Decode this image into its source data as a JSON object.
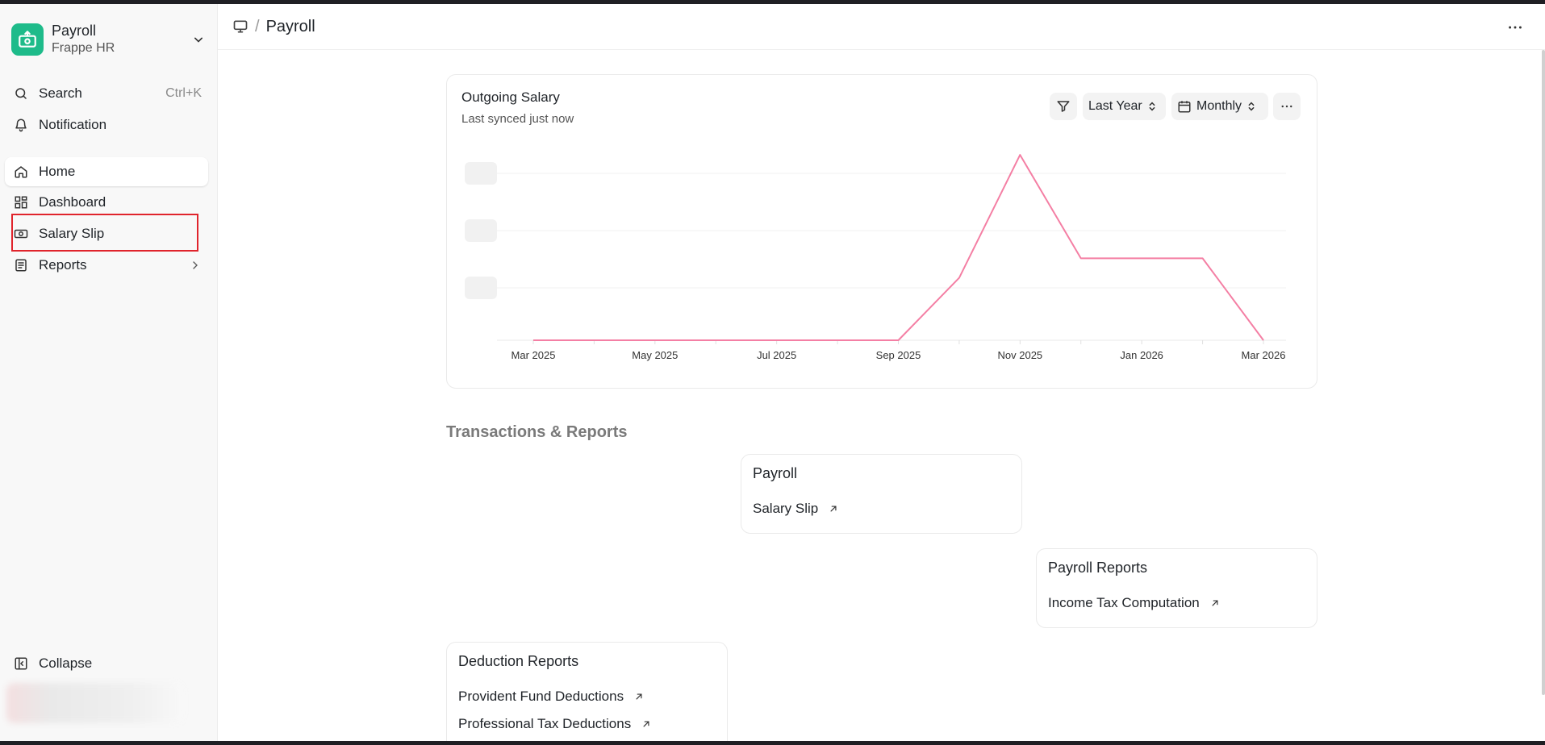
{
  "app": {
    "name": "Payroll",
    "org": "Frappe HR"
  },
  "search": {
    "label": "Search",
    "shortcut": "Ctrl+K"
  },
  "notification": {
    "label": "Notification"
  },
  "sidebar": {
    "items": [
      {
        "label": "Home",
        "icon": "home-icon"
      },
      {
        "label": "Dashboard",
        "icon": "dashboard-icon"
      },
      {
        "label": "Salary Slip",
        "icon": "salary-slip-icon"
      },
      {
        "label": "Reports",
        "icon": "reports-icon"
      }
    ],
    "collapse_label": "Collapse"
  },
  "header": {
    "breadcrumb_sep": "/",
    "page_title": "Payroll"
  },
  "chart_card": {
    "title": "Outgoing Salary",
    "subtitle": "Last synced just now",
    "range_label": "Last Year",
    "interval_label": "Monthly"
  },
  "chart_data": {
    "type": "line",
    "x": [
      "Mar 2025",
      "Apr 2025",
      "May 2025",
      "Jun 2025",
      "Jul 2025",
      "Aug 2025",
      "Sep 2025",
      "Oct 2025",
      "Nov 2025",
      "Dec 2025",
      "Jan 2026",
      "Feb 2026",
      "Mar 2026"
    ],
    "tick_labels": [
      "Mar 2025",
      "May 2025",
      "Jul 2025",
      "Sep 2025",
      "Nov 2025",
      "Jan 2026",
      "Mar 2026"
    ],
    "series": [
      {
        "values": [
          0,
          0,
          0,
          0,
          0,
          0,
          0,
          0.32,
          0.95,
          0.42,
          0.42,
          0.42,
          0
        ]
      }
    ],
    "ylim": [
      0,
      1
    ],
    "y_tick_labels_blurred": true,
    "grid": true,
    "line_color": "#f47fa4"
  },
  "transactions": {
    "title": "Transactions & Reports",
    "cards": [
      {
        "title": "Payroll",
        "links": [
          "Salary Slip"
        ]
      },
      {
        "title": "Payroll Reports",
        "links": [
          "Income Tax Computation"
        ]
      },
      {
        "title": "Deduction Reports",
        "links": [
          "Provident Fund Deductions",
          "Professional Tax Deductions"
        ]
      }
    ]
  }
}
